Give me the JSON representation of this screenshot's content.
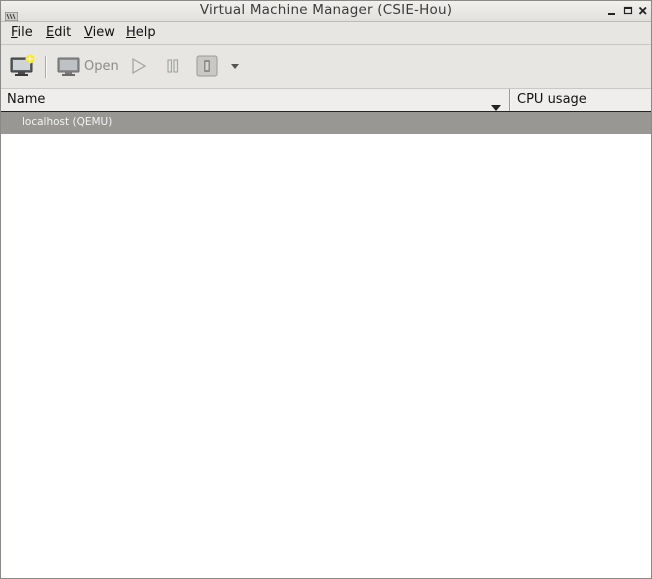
{
  "window": {
    "title": "Virtual Machine Manager (CSIE-Hou)",
    "controls": [
      "minimize-icon",
      "maximize-icon",
      "close-icon"
    ]
  },
  "menu": {
    "file": "File",
    "edit": "Edit",
    "view": "View",
    "help": "Help"
  },
  "toolbar": {
    "open_label": "Open",
    "icons": [
      "new-vm-icon",
      "monitor-icon",
      "play-icon",
      "pause-icon",
      "shutdown-icon",
      "dropdown-arrow-icon"
    ]
  },
  "columns": {
    "name": "Name",
    "cpu": "CPU usage"
  },
  "connections": [
    {
      "label": "localhost (QEMU)",
      "selected": true
    }
  ],
  "colors": {
    "selected_row": "#989794",
    "toolbar_bg": "#e7e6e3",
    "accent_star": "#f5e43a"
  }
}
